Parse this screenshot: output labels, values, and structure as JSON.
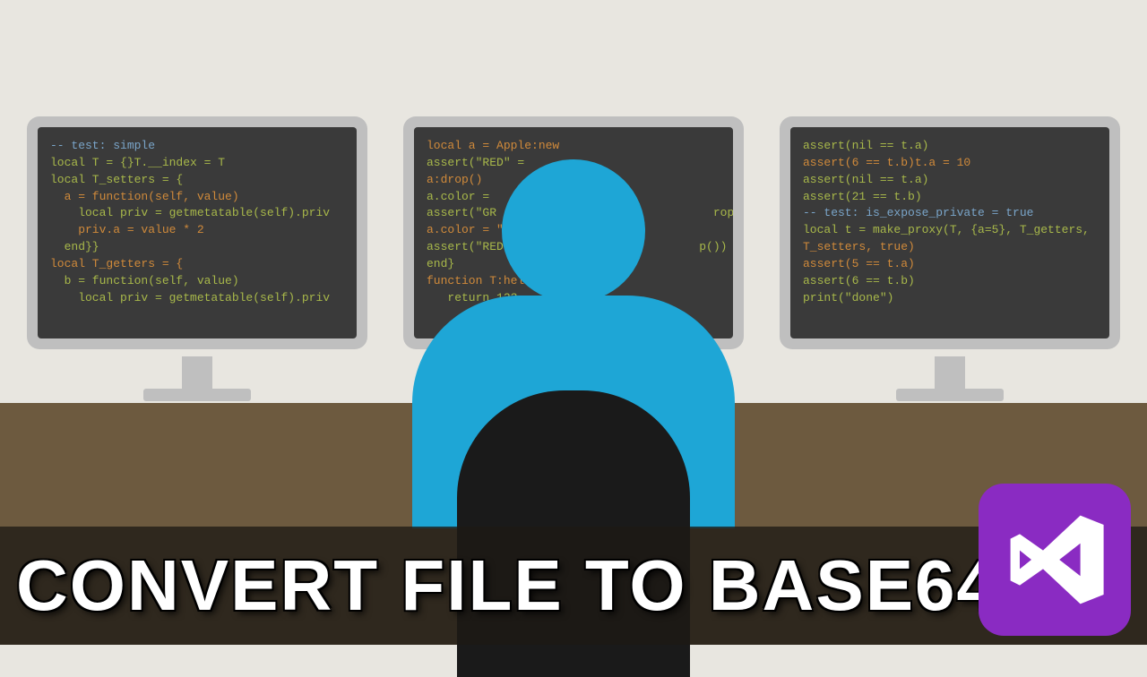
{
  "banner": {
    "title": "CONVERT FILE TO BASE64"
  },
  "logo": {
    "name": "visual-studio"
  },
  "screens": {
    "left": [
      {
        "cls": "c",
        "t": "-- test: simple"
      },
      {
        "cls": "g",
        "t": "local T = {}T.__index = T"
      },
      {
        "cls": "g",
        "t": "local T_setters = {"
      },
      {
        "cls": "o",
        "t": "  a = function(self, value)"
      },
      {
        "cls": "g",
        "t": "    local priv = getmetatable(self).priv"
      },
      {
        "cls": "o",
        "t": "    priv.a = value * 2"
      },
      {
        "cls": "g",
        "t": "  end}}"
      },
      {
        "cls": "o",
        "t": "local T_getters = {"
      },
      {
        "cls": "g",
        "t": "  b = function(self, value)"
      },
      {
        "cls": "g",
        "t": "    local priv = getmetatable(self).priv"
      }
    ],
    "center": [
      {
        "cls": "o",
        "t": "local a = Apple:new"
      },
      {
        "cls": "g",
        "t": "assert(\"RED\" ="
      },
      {
        "cls": "o",
        "t": "a:drop()"
      },
      {
        "cls": "g",
        "t": "a.color ="
      },
      {
        "cls": "g",
        "t": "assert(\"GR                               rop())"
      },
      {
        "cls": "o",
        "t": "a.color = \""
      },
      {
        "cls": "g",
        "t": "assert(\"RED                            p())"
      },
      {
        "cls": "g",
        "t": "end}"
      },
      {
        "cls": "o",
        "t": "function T:hell"
      },
      {
        "cls": "g",
        "t": "   return 123"
      }
    ],
    "right": [
      {
        "cls": "g",
        "t": "assert(nil == t.a)"
      },
      {
        "cls": "o",
        "t": "assert(6 == t.b)t.a = 10"
      },
      {
        "cls": "g",
        "t": "assert(nil == t.a)"
      },
      {
        "cls": "g",
        "t": "assert(21 == t.b)"
      },
      {
        "cls": "c",
        "t": "-- test: is_expose_private = true"
      },
      {
        "cls": "g",
        "t": "local t = make_proxy(T, {a=5}, T_getters,"
      },
      {
        "cls": "o",
        "t": "T_setters, true)"
      },
      {
        "cls": "o",
        "t": "assert(5 == t.a)"
      },
      {
        "cls": "g",
        "t": "assert(6 == t.b)"
      },
      {
        "cls": "g",
        "t": "print(\"done\")"
      }
    ]
  }
}
